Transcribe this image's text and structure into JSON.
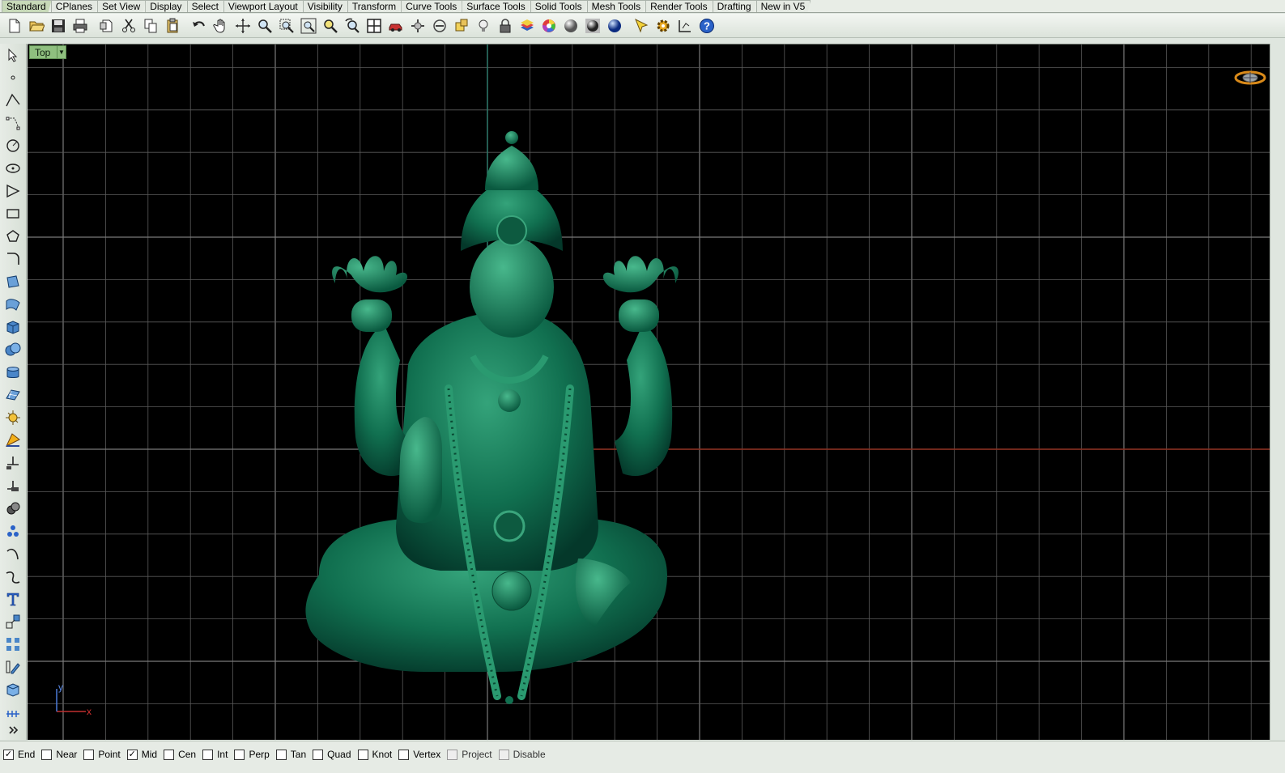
{
  "tabs": [
    {
      "label": "Standard",
      "active": true
    },
    {
      "label": "CPlanes"
    },
    {
      "label": "Set View"
    },
    {
      "label": "Display"
    },
    {
      "label": "Select"
    },
    {
      "label": "Viewport Layout"
    },
    {
      "label": "Visibility"
    },
    {
      "label": "Transform"
    },
    {
      "label": "Curve Tools"
    },
    {
      "label": "Surface Tools"
    },
    {
      "label": "Solid Tools"
    },
    {
      "label": "Mesh Tools"
    },
    {
      "label": "Render Tools"
    },
    {
      "label": "Drafting"
    },
    {
      "label": "New in V5"
    }
  ],
  "toolbar_icons": [
    "new-document-icon",
    "open-folder-icon",
    "save-icon",
    "print-icon",
    "import-icon",
    "cut-icon",
    "copy-icon",
    "paste-icon",
    "undo-icon",
    "pan-hand-icon",
    "rotate-view-icon",
    "zoom-icon",
    "zoom-window-icon",
    "zoom-extents-icon",
    "zoom-selected-icon",
    "undo-view-icon",
    "four-viewports-icon",
    "car-options-icon",
    "osnap-options-icon",
    "cplane-icon",
    "grid-snap-icon",
    "light-bulb-icon",
    "lock-icon",
    "layers-icon",
    "color-wheel-icon",
    "shaded-sphere-icon",
    "rendered-sphere-icon",
    "render-blue-sphere-icon",
    "select-filter-icon",
    "gear-properties-icon",
    "dimension-icon",
    "help-icon"
  ],
  "left_tools": [
    "select-arrow-icon",
    "point-icon",
    "polyline-icon",
    "curve-control-points-icon",
    "circle-icon",
    "ellipse-icon",
    "arc-icon",
    "rectangle-icon",
    "polygon-icon",
    "fillet-curve-icon",
    "surface-corner-points-icon",
    "loft-surface-icon",
    "box-solid-icon",
    "sphere-union-icon",
    "cylinder-icon",
    "planar-surface-icon",
    "explode-icon",
    "split-icon",
    "trim-icon",
    "join-icon",
    "boolean-union-icon",
    "group-icon",
    "fillet-icon",
    "blend-curve-icon",
    "text-icon",
    "transform-icon",
    "array-icon",
    "edit-icon",
    "extrude-icon",
    "dimension-tools-icon",
    "more-chevron-icon"
  ],
  "viewport": {
    "name": "Top",
    "dropdown_icon": "chevron-down-icon",
    "axis_x_label": "x",
    "axis_y_label": "y",
    "background": "#000000",
    "grid_color": "#5a5a5a",
    "x_axis_color": "#8a2a1a",
    "y_axis_color": "#2a7a6a",
    "model_color": "#0e6b4a"
  },
  "osnaps": [
    {
      "label": "End",
      "checked": true
    },
    {
      "label": "Near",
      "checked": false
    },
    {
      "label": "Point",
      "checked": false
    },
    {
      "label": "Mid",
      "checked": true
    },
    {
      "label": "Cen",
      "checked": false
    },
    {
      "label": "Int",
      "checked": false
    },
    {
      "label": "Perp",
      "checked": false
    },
    {
      "label": "Tan",
      "checked": false
    },
    {
      "label": "Quad",
      "checked": false
    },
    {
      "label": "Knot",
      "checked": false
    },
    {
      "label": "Vertex",
      "checked": false
    },
    {
      "label": "Project",
      "checked": false,
      "disabled": true
    },
    {
      "label": "Disable",
      "checked": false,
      "disabled": true
    }
  ]
}
